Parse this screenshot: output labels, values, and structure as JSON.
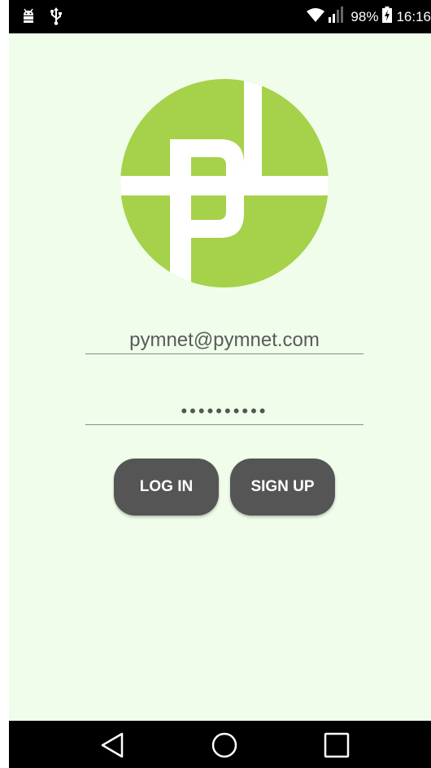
{
  "status_bar": {
    "battery_percent": "98%",
    "time": "16:16",
    "icons": [
      "android-debug-icon",
      "usb-icon",
      "wifi-icon",
      "signal-icon",
      "battery-charging-icon"
    ]
  },
  "logo": {
    "icon": "pymnet-logo",
    "colors": {
      "circle": "#a6d14a",
      "letters": "#ffffff"
    }
  },
  "login_form": {
    "email_value": "pymnet@pymnet.com",
    "password_value": "••••••••••",
    "login_label": "LOG IN",
    "signup_label": "SIGN UP"
  },
  "nav_bar": {
    "icons": [
      "back-icon",
      "home-icon",
      "recent-apps-icon"
    ]
  },
  "colors": {
    "background": "#f0fdea",
    "button": "#555555",
    "bars": "#000000"
  }
}
